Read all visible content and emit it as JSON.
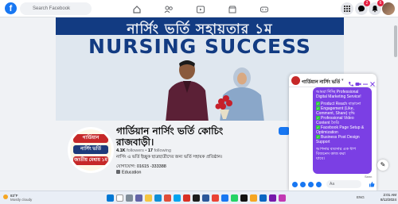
{
  "topbar": {
    "logo": "f",
    "search_placeholder": "Search Facebook",
    "notif_badge": "6",
    "messenger_badge": "2"
  },
  "cover": {
    "banner_text": "নার্সিং ভর্তি সহায়তার ১ম",
    "headline": "NURSING SUCCESS"
  },
  "profile": {
    "pic_lines": [
      "গার্ডিয়ান",
      "নার্সিং ভর্তি রাজবাড়ী",
      "জাতীয় মেধায় ১ম"
    ],
    "name": "গার্ডিয়ান নার্সিং ভর্তি কোচিং রাজবাড়ী।",
    "followers_count": "4.1K",
    "followers_label": "followers",
    "following_count": "17",
    "following_label": "following",
    "bio": "নার্সিং এ ভর্তি ইচ্ছুক ছাত্রছাত্রীদের জন্য ভর্তি সহায়ক প্রতিষ্ঠান।",
    "phone": "যোগাযোগ: 01615 -333388",
    "category": "Education"
  },
  "chat": {
    "title": "গার্ডিয়ান নার্সিং ভর্তি ...",
    "input_placeholder": "Aa",
    "seen_label": "Seen",
    "message_lines": [
      "আমরা দিচ্ছি Professional",
      "Digital Marketing Service!",
      "",
      "Product Reach বাড়ানো",
      "Engagement (Like,",
      "Comment, Share) বৃদ্ধি",
      "Professional Video",
      "Content তৈরি",
      "Facebook Page Setup &",
      "Optimization",
      "Business Post Design",
      "Support",
      "",
      "আপনার ব্যবসার এক ধাপ",
      "বিজনেস কাজ করা",
      "যাবে।"
    ]
  },
  "taskbar": {
    "weather_temp": "83°F",
    "weather_desc": "Mostly cloudy",
    "tray_lang": "ENG",
    "time": "2:01 AM",
    "date": "8/12/2024"
  },
  "colors": {
    "facebook_blue": "#1877f2",
    "chat_bubble": "#7b3fe4",
    "cover_navy": "#123b82"
  }
}
